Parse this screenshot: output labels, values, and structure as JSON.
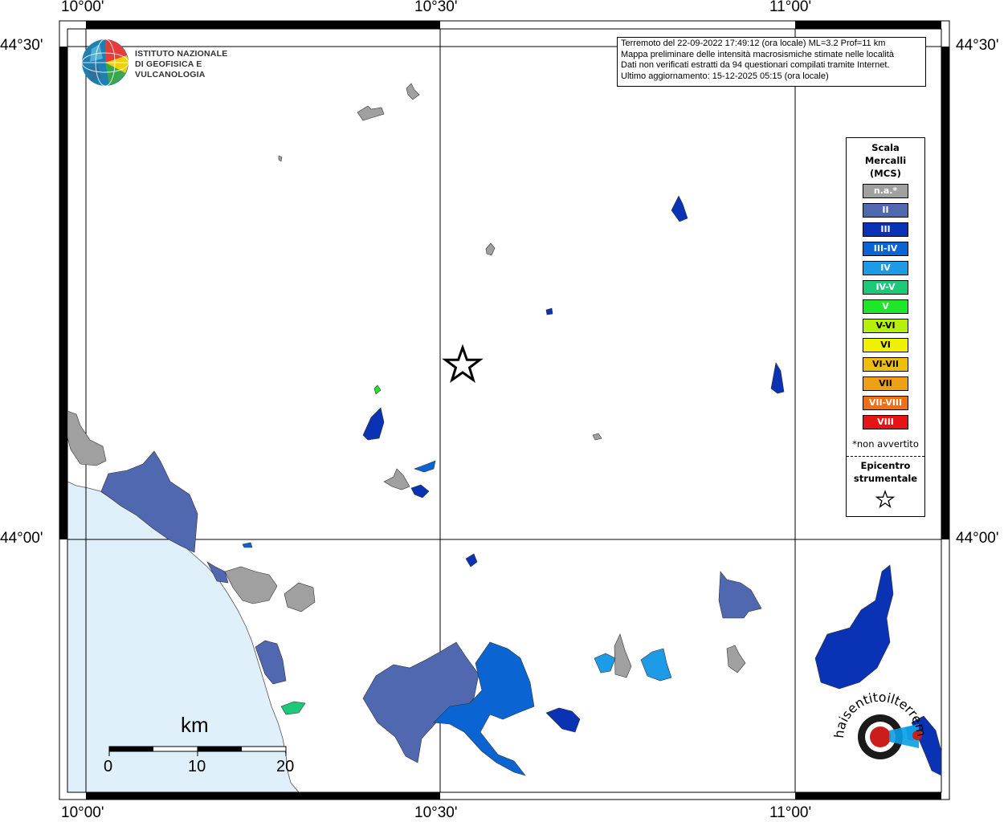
{
  "map": {
    "info_box": [
      "Terremoto del 22-09-2022 17:49:12 (ora locale) ML=3.2 Prof=11 km",
      "Mappa preliminare delle intensità macrosismiche stimate nelle località",
      "Dati non verificati estratti da 94 questionari compilati tramite Internet.",
      "Ultimo aggiornamento: 15-12-2025 05:15 (ora locale)"
    ],
    "longitude_labels": [
      "10°00'",
      "10°30'",
      "11°00'"
    ],
    "latitude_labels": [
      "44°30'",
      "44°00'"
    ],
    "logo_lines": [
      "ISTITUTO NAZIONALE",
      "DI GEOFISICA E VULCANOLOGIA"
    ],
    "scale_bar": {
      "unit": "km",
      "ticks": [
        "0",
        "10",
        "20"
      ]
    },
    "watermark": "haisentitoilterremoto.it  www"
  },
  "legend": {
    "title_lines": [
      "Scala",
      "Mercalli",
      "(MCS)"
    ],
    "items": [
      {
        "label": "n.a.*",
        "color": "#a0a0a0"
      },
      {
        "label": "II",
        "color": "#5068b0"
      },
      {
        "label": "III",
        "color": "#0a32b4"
      },
      {
        "label": "III-IV",
        "color": "#0a64d2"
      },
      {
        "label": "IV",
        "color": "#1e9be6"
      },
      {
        "label": "IV-V",
        "color": "#1ec878"
      },
      {
        "label": "V",
        "color": "#1ee628"
      },
      {
        "label": "V-VI",
        "color": "#b4f00a"
      },
      {
        "label": "VI",
        "color": "#f0f000"
      },
      {
        "label": "VI-VII",
        "color": "#f0be0a"
      },
      {
        "label": "VII",
        "color": "#f0a014"
      },
      {
        "label": "VII-VIII",
        "color": "#f06e14"
      },
      {
        "label": "VIII",
        "color": "#e61414"
      }
    ],
    "note": "*non avvertito",
    "epicenter_lines": [
      "Epicentro",
      "strumentale"
    ],
    "epicenter_icon": "star-outline-icon"
  },
  "colors": {
    "sea": "#dff0fb",
    "land": "#ffffff",
    "frame": "#000000"
  }
}
